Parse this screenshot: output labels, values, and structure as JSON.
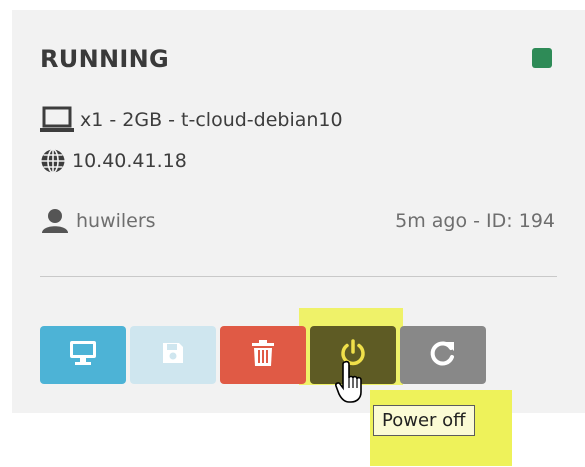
{
  "instance": {
    "status": "RUNNING",
    "status_color": "#2e8b57",
    "spec": "x1 - 2GB - t-cloud-debian10",
    "ip": "10.40.41.18",
    "user": "huwilers",
    "meta": "5m ago - ID: 194"
  },
  "icons": {
    "spec": "laptop-icon",
    "ip": "globe-icon",
    "user": "user-icon"
  },
  "actions": [
    {
      "name": "console",
      "icon": "desktop-icon",
      "color": "#4db3d6",
      "enabled": true
    },
    {
      "name": "save",
      "icon": "floppy-disk-icon",
      "color": "#cfe6ef",
      "enabled": false
    },
    {
      "name": "delete",
      "icon": "trash-icon",
      "color": "#e05a45",
      "enabled": true
    },
    {
      "name": "power-off",
      "icon": "power-icon",
      "color": "#5e5b24",
      "enabled": true
    },
    {
      "name": "restart",
      "icon": "refresh-icon",
      "color": "#888888",
      "enabled": true
    }
  ],
  "tooltip": "Power off",
  "highlight_color": "#eef25a"
}
